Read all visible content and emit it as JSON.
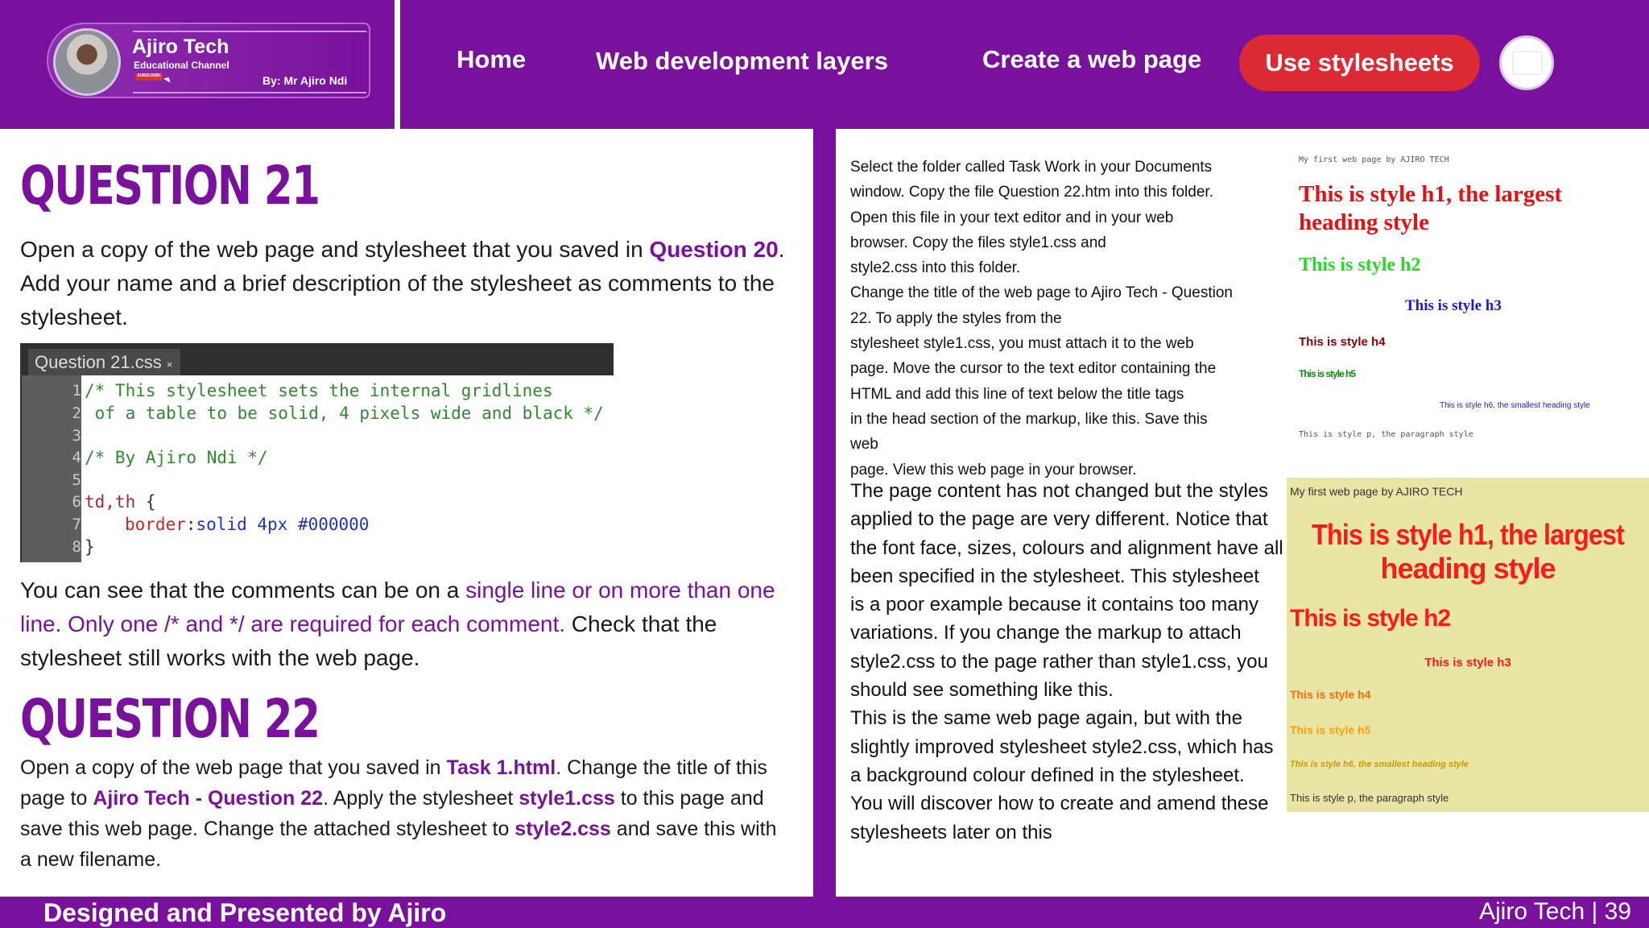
{
  "brand": {
    "title": "Ajiro Tech",
    "subtitle": "Educational Channel",
    "subscribe": "SUBSCRIBE",
    "by": "By: Mr Ajiro Ndi"
  },
  "nav": {
    "items": [
      "Home",
      "Web development layers",
      "Create a web page"
    ],
    "active": "Use stylesheets"
  },
  "q21": {
    "title": "QUESTION 21",
    "p1_a": "Open a copy of the web page and stylesheet that you saved in ",
    "p1_link": "Question 20",
    "p1_b": ". Add your name and a brief description of the stylesheet as comments to the stylesheet.",
    "code": {
      "tab": "Question 21.css",
      "tab_close": "×",
      "lines": [
        {
          "n": "1",
          "text": "/* This stylesheet sets the internal gridlines"
        },
        {
          "n": "2",
          "text": " of a table to be solid, 4 pixels wide and black */"
        },
        {
          "n": "3",
          "text": ""
        },
        {
          "n": "4",
          "text": "/* By Ajiro Ndi */"
        },
        {
          "n": "5",
          "text": ""
        },
        {
          "n": "6",
          "selector": "td,th",
          "brace": " {"
        },
        {
          "n": "7",
          "prop": "border",
          "colon": ":",
          "value": "solid 4px #000000"
        },
        {
          "n": "8",
          "text": "}"
        }
      ]
    },
    "p2_a": "You can see that the comments can be on a ",
    "p2_hl": "single line or on more than one line. Only one /* and */ are required for each comment.",
    "p2_b": " Check that the stylesheet still works with the web page."
  },
  "q22": {
    "title": "QUESTION 22",
    "p_a": "Open a copy of the web page that you saved in ",
    "p_task": "Task 1.html",
    "p_b": ". Change the title of this page to ",
    "p_title": "Ajiro Tech - Question 22",
    "p_c": ". Apply the stylesheet ",
    "p_s1": "style1.css",
    "p_d": " to this page and save this web page. Change the attached stylesheet to ",
    "p_s2": "style2.css",
    "p_e": " and save this with a new filename."
  },
  "right": {
    "instructions": [
      "Select the folder called Task Work in your Documents",
      "window. Copy the file Question 22.htm into this folder.",
      "Open this file in your text editor and in your web",
      "browser. Copy the files style1.css and",
      "style2.css into this folder.",
      "Change the title of the web page to Ajiro Tech - Question",
      "22. To apply the styles from the",
      "stylesheet style1.css, you must attach it to the web",
      "page. Move the cursor to the text editor containing the",
      "HTML and add this line of text below the title tags",
      "in the head section of the markup, like this. Save this",
      "web",
      "page. View this web page in your browser."
    ],
    "explanation": [
      "The page content has not changed but the styles",
      "applied to the page are very different. Notice that",
      "the font face, sizes, colours and alignment have all",
      "been specified in the stylesheet. This stylesheet",
      "is a poor example because it contains too many",
      "variations. If you change the markup to attach",
      "style2.css to the page rather than style1.css, you",
      "should see something like this.",
      "This is the same web page again, but with the",
      "slightly improved stylesheet style2.css, which has",
      "a background colour defined in the stylesheet.",
      "You will discover how to create and amend these",
      "stylesheets later on this"
    ]
  },
  "preview1": {
    "title": "My first web page by AJIRO TECH",
    "h1a": "This is style h1, the largest",
    "h1b": "heading style",
    "h2": "This is style h2",
    "h3": "This is style h3",
    "h4": "This is style h4",
    "h5": "This is style h5",
    "h6": "This is style h6, the smallest heading style",
    "p": "This is style p, the paragraph style"
  },
  "preview2": {
    "title": "My first web page by AJIRO TECH",
    "h1a": "This is style h1, the largest",
    "h1b": "heading style",
    "h2": "This is style h2",
    "h3": "This is style h3",
    "h4": "This is style h4",
    "h5": "This is style h5",
    "h6": "This is style h6, the smallest heading style",
    "p": "This is style p, the paragraph style",
    "background": "#e9e5a5"
  },
  "footer": {
    "left": "Designed and Presented by Ajiro",
    "right": "Ajiro Tech | 39"
  },
  "colors": {
    "brand": "#7a119c",
    "accent": "#dc2a34"
  }
}
